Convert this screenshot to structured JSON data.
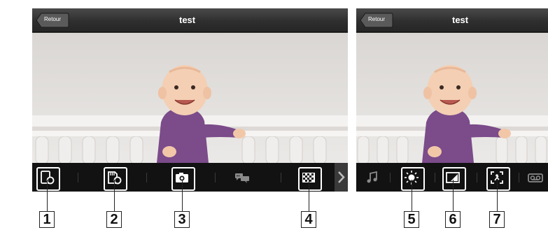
{
  "left_screen": {
    "title": "test",
    "back_label": "Retour",
    "toolbar_icons": [
      "video-frame-icon",
      "sd-card-record-icon",
      "camera-icon",
      "talk-icon",
      "checker-quality-icon",
      "chevron-right-icon"
    ]
  },
  "right_screen": {
    "title": "test",
    "back_label": "Retour",
    "toolbar_icons": [
      "music-note-icon",
      "brightness-icon",
      "contrast-icon",
      "zoom-icon",
      "recording-icon"
    ]
  },
  "callouts": [
    "1",
    "2",
    "3",
    "4",
    "5",
    "6",
    "7"
  ],
  "colors": {
    "navbar": "#2f2f2f",
    "toolbar": "#121212",
    "wall": "#e6e4e2",
    "crib": "#f2f0ee",
    "shirt": "#7b4b8a"
  }
}
